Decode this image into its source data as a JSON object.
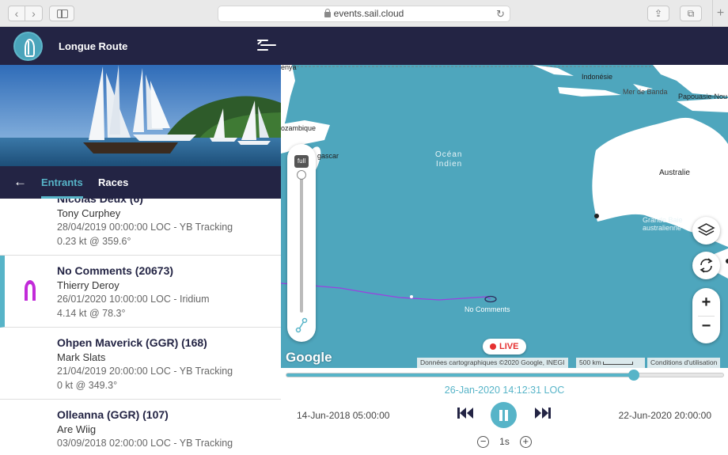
{
  "browser": {
    "url": "events.sail.cloud"
  },
  "app": {
    "title": "Longue Route"
  },
  "tabs": {
    "entrants": "Entrants",
    "races": "Races"
  },
  "entries": [
    {
      "name": "Nicolas Deux (6)",
      "skipper": "Tony Curphey",
      "time": "28/04/2019 00:00:00 LOC - YB Tracking",
      "speed": "0.23 kt @ 359.6°"
    },
    {
      "name": "No Comments (20673)",
      "skipper": "Thierry Deroy",
      "time": "26/01/2020 10:00:00 LOC - Iridium",
      "speed": "4.14 kt @ 78.3°",
      "selected": true,
      "boat_color": "#c22bd9"
    },
    {
      "name": "Ohpen Maverick (GGR) (168)",
      "skipper": "Mark Slats",
      "time": "21/04/2019 20:00:00 LOC - YB Tracking",
      "speed": "0 kt @ 349.3°"
    },
    {
      "name": "Olleanna (GGR) (107)",
      "skipper": "Are Wiig",
      "time": "03/09/2018 02:00:00 LOC - YB Tracking",
      "speed": ""
    }
  ],
  "map": {
    "labels": {
      "kenya": "enya",
      "mozambique": "ozambique",
      "madagascar": "gascar",
      "indonesia": "Indonésie",
      "banda": "Mer de Banda",
      "papua": "Papouasie-Nou",
      "australia": "Australie",
      "bight": "Grande Baie australienne",
      "ocean_line1": "Océan",
      "ocean_line2": "Indien",
      "boat_label": "No Comments"
    },
    "full_badge": "full",
    "google": "Google",
    "attribution": "Données cartographiques ©2020 Google, INEGI",
    "scale": "500 km",
    "terms": "Conditions d'utilisation",
    "live": "LIVE"
  },
  "playback": {
    "current": "26-Jan-2020 14:12:31 LOC",
    "start": "14-Jun-2018 05:00:00",
    "end": "22-Jun-2020 20:00:00",
    "speed": "1s",
    "progress": 0.795
  },
  "colors": {
    "navy": "#232444",
    "teal": "#57b4c8",
    "ocean": "#4ea6bd",
    "land": "#ffffff",
    "track": "#9b40e0"
  }
}
